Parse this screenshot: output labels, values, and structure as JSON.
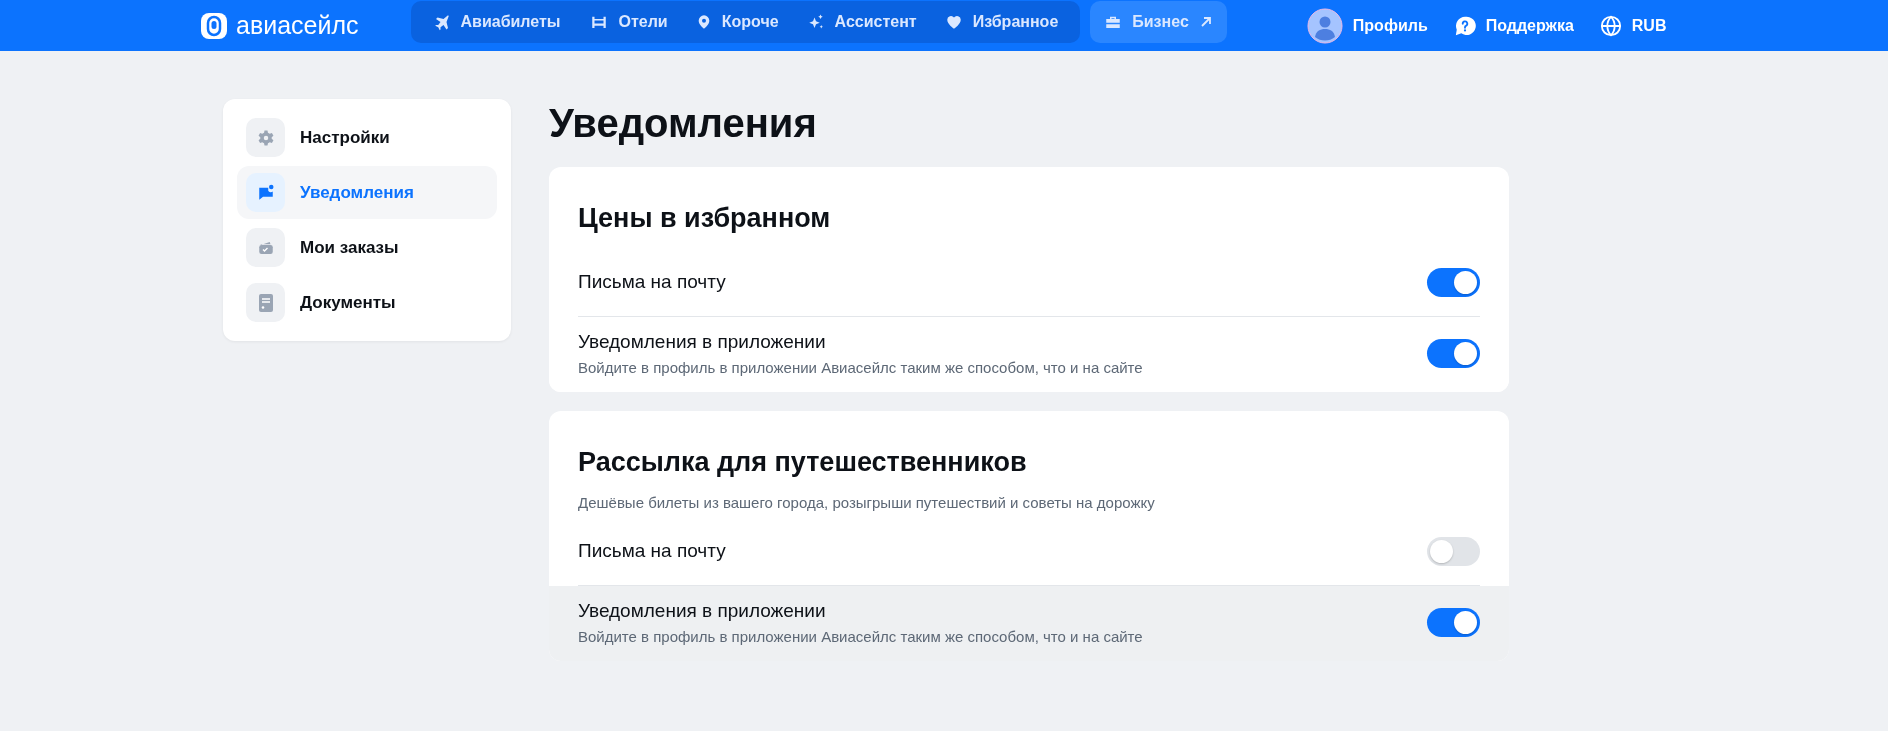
{
  "header": {
    "logo": "авиасейлс",
    "nav": [
      {
        "kind": "plane",
        "label": "Авиабилеты"
      },
      {
        "kind": "bed",
        "label": "Отели"
      },
      {
        "kind": "pin",
        "label": "Короче"
      },
      {
        "kind": "sparkle",
        "label": "Ассистент"
      },
      {
        "kind": "heart",
        "label": "Избранное"
      }
    ],
    "business": {
      "label": "Бизнес"
    },
    "right": [
      {
        "kind": "avatar",
        "label": "Профиль"
      },
      {
        "kind": "help",
        "label": "Поддержка"
      },
      {
        "kind": "globe",
        "label": "RUB"
      }
    ]
  },
  "sidebar": {
    "items": [
      {
        "kind": "gear",
        "label": "Настройки",
        "selected": false
      },
      {
        "kind": "chat",
        "label": "Уведомления",
        "selected": true
      },
      {
        "kind": "wallet",
        "label": "Мои заказы",
        "selected": false
      },
      {
        "kind": "doc",
        "label": "Документы",
        "selected": false
      }
    ]
  },
  "page_title": "Уведомления",
  "sections": [
    {
      "title": "Цены в избранном",
      "rows": [
        {
          "label": "Письма на почту",
          "on": true,
          "highlighted": false
        },
        {
          "label": "Уведомления в приложении",
          "hint": "Войдите в профиль в приложении Авиасейлс таким же способом, что и на сайте",
          "on": true,
          "highlighted": false
        }
      ]
    },
    {
      "title": "Рассылка для путешественников",
      "subtitle": "Дешёвые билеты из вашего города, розыгрыши путешествий и советы на дорожку",
      "rows": [
        {
          "label": "Письма на почту",
          "on": false,
          "highlighted": false
        },
        {
          "label": "Уведомления в приложении",
          "hint": "Войдите в профиль в приложении Авиасейлс таким же способом, что и на сайте",
          "on": true,
          "highlighted": true
        }
      ]
    }
  ]
}
